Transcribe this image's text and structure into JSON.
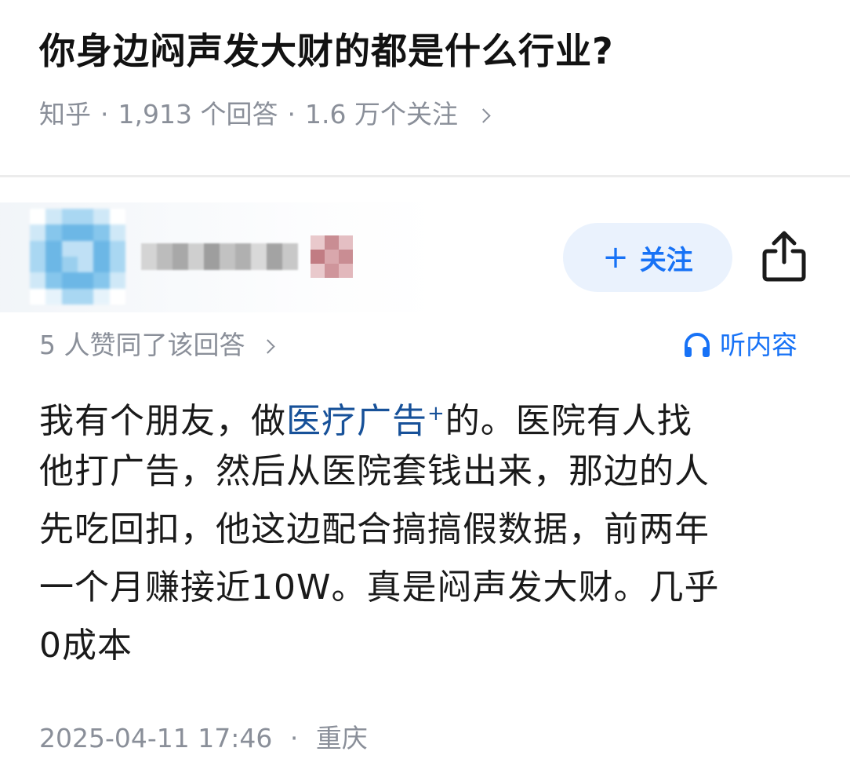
{
  "question": {
    "title": "你身边闷声发大财的都是什么行业?",
    "source": "知乎",
    "answer_count": "1,913 个回答",
    "follower_count": "1.6 万个关注",
    "separator": "·"
  },
  "author": {
    "follow_label": "关注",
    "follow_plus": "+"
  },
  "answer": {
    "votes_text": "5 人赞同了该回答",
    "listen_label": "听内容",
    "body_lines": {
      "l1_before": "我有个朋友，做",
      "l1_keyword": "医疗广告",
      "l1_keyword_mark": "+",
      "l1_after": "的。医院有人找",
      "l2": "他打广告，然后从医院套钱出来，那边的人",
      "l3": "先吃回扣，他这边配合搞搞假数据，前两年",
      "l4": "一个月赚接近10W。真是闷声发大财。几乎",
      "l5": "0成本"
    },
    "timestamp": "2025-04-11 17:46",
    "location": "重庆",
    "footer_separator": "·"
  },
  "colors": {
    "accent": "#1772f6",
    "keyword": "#175199",
    "meta_gray": "#8a8f99",
    "follow_bg": "#eaf2fd"
  },
  "icons": {
    "share": "share-icon",
    "listen": "headphones-icon",
    "meta_chevron": "chevron-right-icon"
  }
}
